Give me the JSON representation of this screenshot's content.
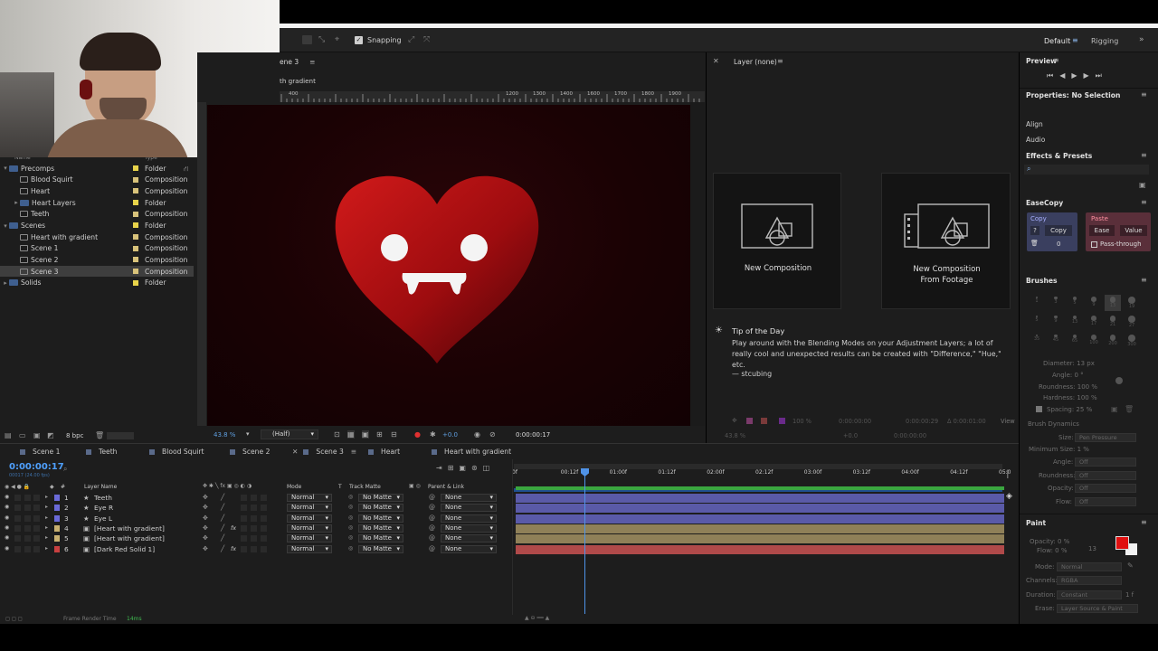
{
  "toolbar": {
    "snapping": "Snapping",
    "workspaces": [
      "Default",
      "Rigging"
    ]
  },
  "project": {
    "header_name": "Name",
    "header_type": "Type",
    "items": [
      {
        "name": "Precomps",
        "type": "Folder",
        "kind": "folder",
        "indent": 0,
        "twirl": "▾",
        "label": "#e8d34a"
      },
      {
        "name": "Blood Squirt",
        "type": "Composition",
        "kind": "comp",
        "indent": 1,
        "twirl": "",
        "label": "#d8c27a"
      },
      {
        "name": "Heart",
        "type": "Composition",
        "kind": "comp",
        "indent": 1,
        "twirl": "",
        "label": "#d8c27a"
      },
      {
        "name": "Heart Layers",
        "type": "Folder",
        "kind": "folder",
        "indent": 1,
        "twirl": "▸",
        "label": "#e8d34a"
      },
      {
        "name": "Teeth",
        "type": "Composition",
        "kind": "comp",
        "indent": 1,
        "twirl": "",
        "label": "#d8c27a"
      },
      {
        "name": "Scenes",
        "type": "Folder",
        "kind": "folder",
        "indent": 0,
        "twirl": "▾",
        "label": "#e8d34a"
      },
      {
        "name": "Heart with gradient",
        "type": "Composition",
        "kind": "comp",
        "indent": 1,
        "twirl": "",
        "label": "#d8c27a"
      },
      {
        "name": "Scene 1",
        "type": "Composition",
        "kind": "comp",
        "indent": 1,
        "twirl": "",
        "label": "#d8c27a"
      },
      {
        "name": "Scene 2",
        "type": "Composition",
        "kind": "comp",
        "indent": 1,
        "twirl": "",
        "label": "#d8c27a"
      },
      {
        "name": "Scene 3",
        "type": "Composition",
        "kind": "comp",
        "indent": 1,
        "twirl": "",
        "label": "#d8c27a",
        "selected": true
      },
      {
        "name": "Solids",
        "type": "Folder",
        "kind": "folder",
        "indent": 0,
        "twirl": "▸",
        "label": "#e8d34a"
      }
    ],
    "bpc": "8 bpc"
  },
  "viewer": {
    "tab": "ene 3",
    "subtab": "th gradient",
    "ruler_ticks": [
      "400",
      "1200",
      "1300",
      "1400",
      "1600",
      "1700",
      "1800",
      "1900"
    ],
    "zoom": "43.8 %",
    "resolution": "(Half)",
    "exposure": "+0.0",
    "timecode": "0:00:00:17"
  },
  "layer_panel": {
    "title": "Layer (none)"
  },
  "start": {
    "new_comp": "New Composition",
    "new_comp_footage_1": "New Composition",
    "new_comp_footage_2": "From Footage",
    "tip_title": "Tip of the Day",
    "tip_text": "Play around with the Blending Modes on your Adjustment Layers; a lot of really cool and unexpected results can be created with \"Difference,\" \"Hue,\" etc.",
    "tip_author": "— stcubing",
    "footer_zoom": "100 %",
    "footer_t1": "0:00:00:00",
    "footer_t2": "0:00:00:29",
    "footer_t3": "Δ 0:00:01:00",
    "footer_view": "View",
    "footer2_zoom": "43.8 %",
    "footer2_exp": "+0.0",
    "footer2_tc": "0:00:00:00"
  },
  "right": {
    "preview": "Preview",
    "properties": "Properties: No Selection",
    "align": "Align",
    "audio": "Audio",
    "effects": "Effects & Presets",
    "easecopy": "EaseCopy",
    "copy_label": "Copy",
    "copy_q": "?",
    "copy_btn": "Copy",
    "copy_num": "0",
    "paste_label": "Paste",
    "ease_btn": "Ease",
    "value_btn": "Value",
    "passthrough": "Pass-through",
    "brushes": "Brushes",
    "brush_sizes": [
      "1",
      "3",
      "5",
      "9",
      "13",
      "19",
      "5",
      "9",
      "13",
      "17",
      "21",
      "27",
      "35",
      "45",
      "65",
      "100",
      "200",
      "300"
    ],
    "diameter": "Diameter: 13 px",
    "angle": "Angle: 0 °",
    "roundness": "Roundness: 100 %",
    "hardness": "Hardness: 100 %",
    "spacing": "Spacing: 25 %",
    "dynamics": "Brush Dynamics",
    "size_label": "Size:",
    "size_val": "Pen Pressure",
    "minsize": "Minimum Size: 1 %",
    "angle_label": "Angle:",
    "roundness_label": "Roundness:",
    "opacity_label": "Opacity:",
    "flow_label": "Flow:",
    "off": "Off",
    "paint": "Paint",
    "paint_opacity": "Opacity: 0 %",
    "paint_flow": "Flow: 0 %",
    "paint_num": "13",
    "mode_label": "Mode:",
    "mode_val": "Normal",
    "channels_label": "Channels:",
    "channels_val": "RGBA",
    "duration_label": "Duration:",
    "duration_val": "Constant",
    "duration_num": "1 f",
    "erase_label": "Erase:",
    "erase_val": "Layer Source & Paint",
    "paint_color": "#e01010"
  },
  "timeline": {
    "tabs": [
      {
        "name": "Scene 1",
        "color": "#5a6a8a"
      },
      {
        "name": "Teeth",
        "color": "#5a6a8a"
      },
      {
        "name": "Blood Squirt",
        "color": "#5a6a8a"
      },
      {
        "name": "Scene 2",
        "color": "#5a6a8a"
      },
      {
        "name": "Scene 3",
        "color": "#5a6a8a",
        "active": true
      },
      {
        "name": "Heart",
        "color": "#5a6a8a"
      },
      {
        "name": "Heart with gradient",
        "color": "#5a6a8a"
      }
    ],
    "timecode": "0:00:00:17",
    "timecode_sub": "00017 (24.00 fps)",
    "col_layer": "Layer Name",
    "col_mode": "Mode",
    "col_t": "T",
    "col_trk": "Track Matte",
    "col_parent": "Parent & Link",
    "ruler": [
      "0f",
      "00:12f",
      "01:00f",
      "01:12f",
      "02:00f",
      "02:12f",
      "03:00f",
      "03:12f",
      "04:00f",
      "04:12f",
      "05:0"
    ],
    "layers": [
      {
        "num": "1",
        "name": "Teeth",
        "star": true,
        "label": "#6a6ad8",
        "mode": "Normal",
        "matte": "No Matte",
        "parent": "None",
        "bar": "#5a5aa8",
        "fx": false
      },
      {
        "num": "2",
        "name": "Eye R",
        "star": true,
        "label": "#6a6ad8",
        "mode": "Normal",
        "matte": "No Matte",
        "parent": "None",
        "bar": "#5a5aa8",
        "fx": false
      },
      {
        "num": "3",
        "name": "Eye L",
        "star": true,
        "label": "#6a6ad8",
        "mode": "Normal",
        "matte": "No Matte",
        "parent": "None",
        "bar": "#5a5aa8",
        "fx": false
      },
      {
        "num": "4",
        "name": "[Heart with gradient]",
        "star": false,
        "label": "#c8b070",
        "mode": "Normal",
        "matte": "No Matte",
        "parent": "None",
        "bar": "#8f8058",
        "fx": true
      },
      {
        "num": "5",
        "name": "[Heart with gradient]",
        "star": false,
        "label": "#c8b070",
        "mode": "Normal",
        "matte": "No Matte",
        "parent": "None",
        "bar": "#8f8058",
        "fx": false
      },
      {
        "num": "6",
        "name": "[Dark Red Solid 1]",
        "star": false,
        "label": "#c84040",
        "mode": "Normal",
        "matte": "No Matte",
        "parent": "None",
        "bar": "#b04a4a",
        "fx": true
      }
    ],
    "frame_render": "Frame Render Time",
    "frame_render_val": "14ms"
  }
}
